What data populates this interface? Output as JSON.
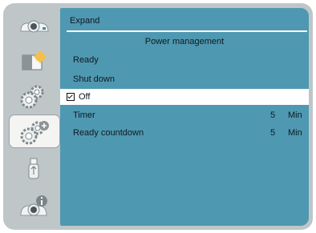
{
  "menu": {
    "tab_label": "Expand",
    "heading": "Power management",
    "items": [
      {
        "label": "Ready"
      },
      {
        "label": "Shut down"
      },
      {
        "label": "Off",
        "selected": true,
        "checked": true
      }
    ],
    "settings": [
      {
        "label": "Timer",
        "value": "5",
        "unit": "Min"
      },
      {
        "label": "Ready countdown",
        "value": "5",
        "unit": "Min"
      }
    ]
  },
  "sidebar": {
    "items": [
      {
        "icon": "display-icon"
      },
      {
        "icon": "image-adjust-icon"
      },
      {
        "icon": "settings-gear-icon"
      },
      {
        "icon": "expand-settings-icon",
        "active": true
      },
      {
        "icon": "usb-icon"
      },
      {
        "icon": "info-icon"
      }
    ]
  },
  "colors": {
    "panel": "#4f98b1",
    "frame": "#bfc6c8",
    "selected_row": "#ffffff"
  }
}
